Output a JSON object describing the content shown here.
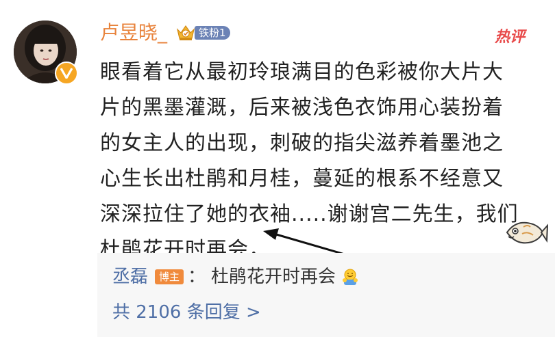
{
  "comment": {
    "username": "卢昱晓_",
    "fan_badge": "铁粉1",
    "hot_tag": "热评",
    "content_lines": [
      "眼看着它从最初玲琅满目的色彩被你大片大",
      "片的黑墨灌溉，后来被浅色衣饰用心装扮着",
      "的女主人的出现，刺破的指尖滋养着墨池之",
      "心生长出杜鹃和月桂，蔓延的根系不经意又",
      "深深拉住了她的衣袖.....谢谢宫二先生，我们",
      "杜鹃花开时再会，"
    ]
  },
  "reply": {
    "username": "丞磊",
    "tag": "博主",
    "colon": "：",
    "text": "杜鹃花开时再会",
    "emoji": "hugging-emoji",
    "count_text": "共 2106 条回复 >"
  },
  "colors": {
    "username": "#e8823a",
    "link": "#4f6fa6",
    "hot": "#e84a4a",
    "badge": "#6b82b5",
    "blogger_tag": "#f08a3c"
  }
}
